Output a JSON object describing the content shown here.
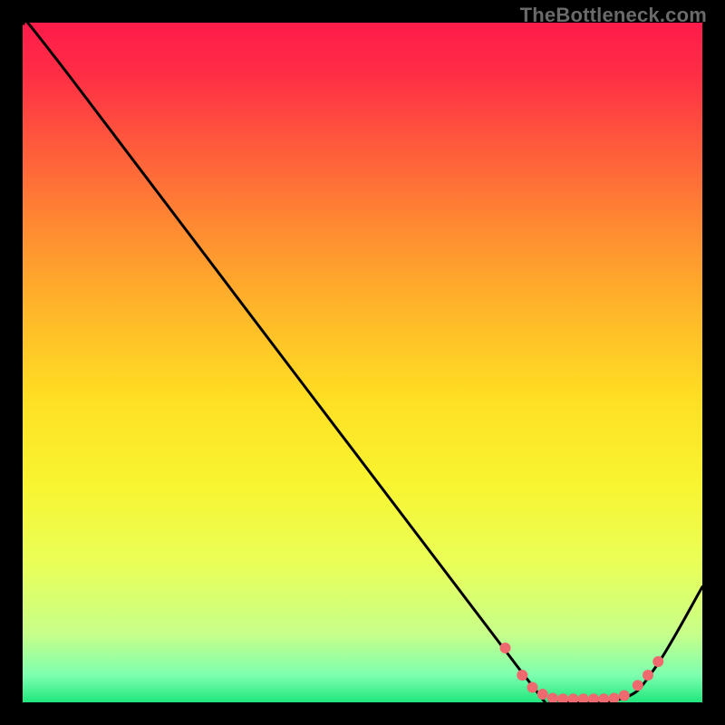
{
  "watermark": "TheBottleneck.com",
  "chart_data": {
    "type": "line",
    "title": "",
    "xlabel": "",
    "ylabel": "",
    "xlim": [
      0,
      100
    ],
    "ylim": [
      0,
      100
    ],
    "grid": false,
    "legend": false,
    "gradient_stops": [
      {
        "offset": 0,
        "color": "#ff1b4b"
      },
      {
        "offset": 0.08,
        "color": "#ff2f45"
      },
      {
        "offset": 0.18,
        "color": "#ff5a3c"
      },
      {
        "offset": 0.3,
        "color": "#ff8a32"
      },
      {
        "offset": 0.42,
        "color": "#ffb52a"
      },
      {
        "offset": 0.55,
        "color": "#ffde23"
      },
      {
        "offset": 0.68,
        "color": "#f8f531"
      },
      {
        "offset": 0.8,
        "color": "#e9ff5a"
      },
      {
        "offset": 0.9,
        "color": "#c7ff8a"
      },
      {
        "offset": 0.96,
        "color": "#7dffb0"
      },
      {
        "offset": 1.0,
        "color": "#20e77d"
      }
    ],
    "series": [
      {
        "name": "bottleneck-curve",
        "color": "#000000",
        "x": [
          0,
          7,
          73,
          78,
          88,
          93,
          100
        ],
        "values": [
          100,
          92,
          5,
          0.5,
          0.5,
          5,
          17
        ]
      }
    ],
    "markers": {
      "name": "highlight-dots",
      "color": "#ef6a6e",
      "radius": 6,
      "points": [
        {
          "x": 71.0,
          "y": 8.0
        },
        {
          "x": 73.5,
          "y": 4.0
        },
        {
          "x": 75.0,
          "y": 2.2
        },
        {
          "x": 76.5,
          "y": 1.2
        },
        {
          "x": 78.0,
          "y": 0.6
        },
        {
          "x": 79.5,
          "y": 0.5
        },
        {
          "x": 81.0,
          "y": 0.5
        },
        {
          "x": 82.5,
          "y": 0.5
        },
        {
          "x": 84.0,
          "y": 0.5
        },
        {
          "x": 85.5,
          "y": 0.5
        },
        {
          "x": 87.0,
          "y": 0.6
        },
        {
          "x": 88.5,
          "y": 1.0
        },
        {
          "x": 90.5,
          "y": 2.5
        },
        {
          "x": 92.0,
          "y": 4.0
        },
        {
          "x": 93.5,
          "y": 6.0
        }
      ]
    }
  }
}
